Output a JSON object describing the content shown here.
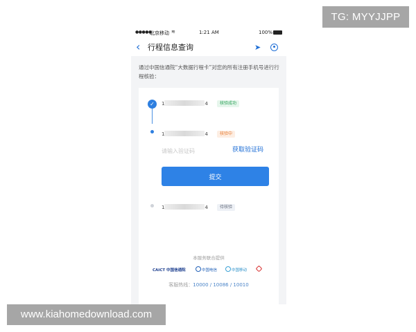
{
  "watermark": {
    "tg": "TG: MYYJJPP",
    "site": "www.kiahomedownload.com"
  },
  "statusbar": {
    "signal": "●●●●●",
    "carrier": "北京移动",
    "wifi_icon": "wifi-icon",
    "time": "1:21 AM",
    "battery_pct": "100%"
  },
  "navbar": {
    "back_icon": "chevron-left-icon",
    "title": "行程信息查询",
    "locate_icon": "location-arrow-icon",
    "refresh_icon": "refresh-icon"
  },
  "intro": "通过中国信通院“大数据行程卡”对您的所有注册手机号进行行程核验：",
  "numbers": [
    {
      "head": "1",
      "tail": "4",
      "status": "核验成功"
    },
    {
      "head": "1",
      "tail": "4",
      "status": "核验中"
    },
    {
      "head": "1",
      "tail": "4",
      "status": "待核验"
    }
  ],
  "code_input": {
    "placeholder": "请输入验证码",
    "value": ""
  },
  "get_code_label": "获取验证码",
  "submit_label": "提交",
  "service_provided": "本服务联合提供",
  "logos": {
    "caict": "CAICT 中国信通院",
    "telecom": "中国电信",
    "mobile": "中国移动",
    "unicom": ""
  },
  "hotline": {
    "label": "客服热线：",
    "numbers": "10000 / 10086 / 10010"
  },
  "colors": {
    "accent": "#2e82e6",
    "success": "#2ea35a",
    "pending": "#e8813a"
  }
}
